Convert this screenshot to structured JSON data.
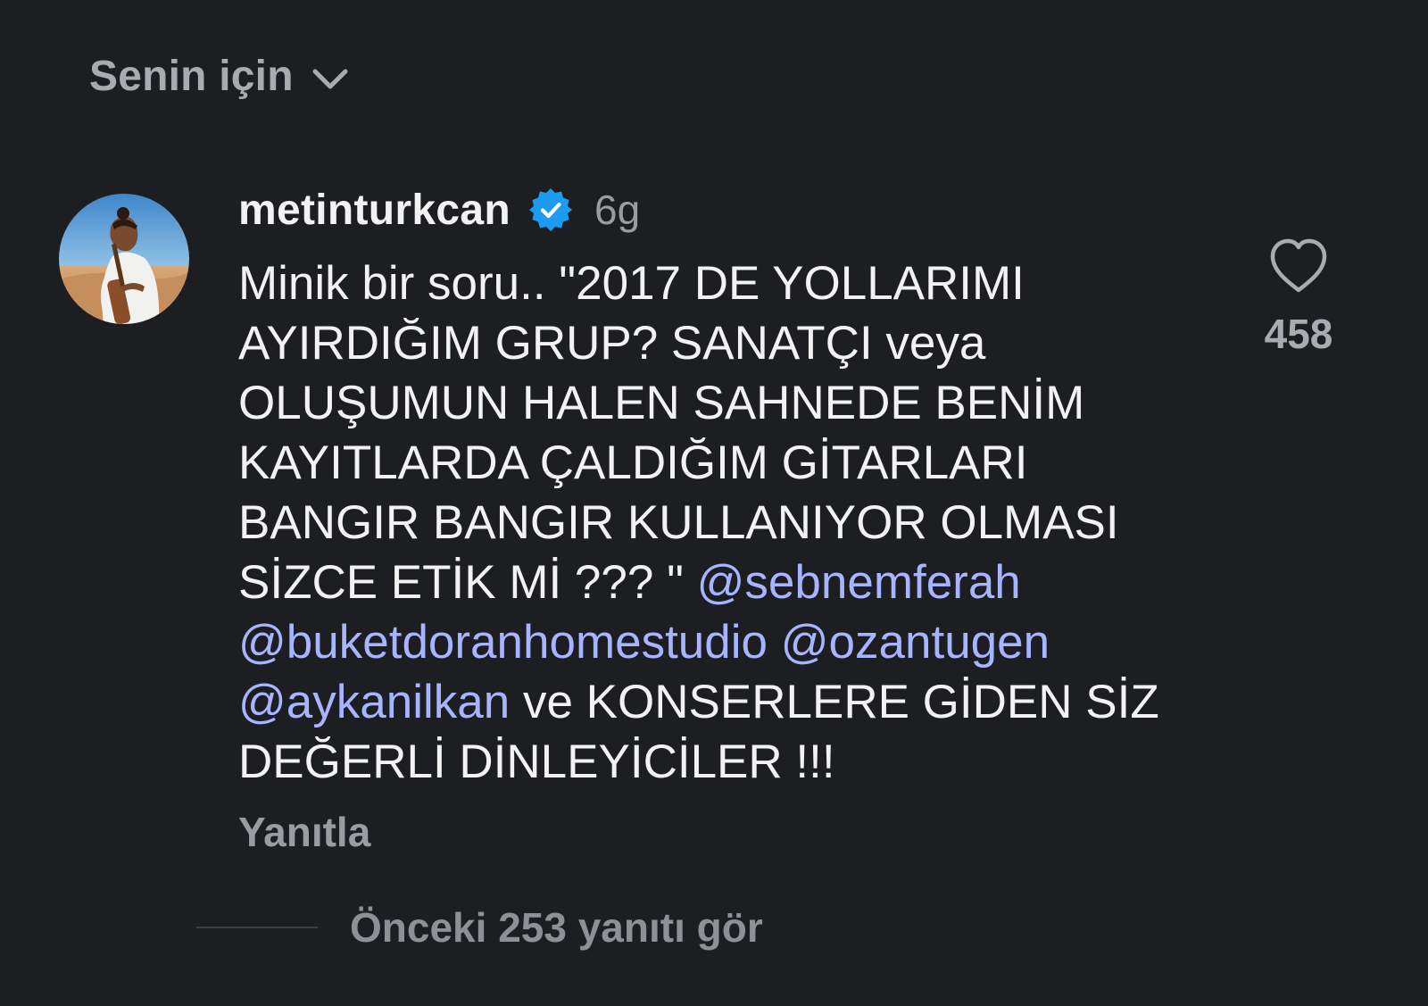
{
  "header": {
    "feed_selector_label": "Senin için",
    "chevron_icon": "chevron-down-icon"
  },
  "comment": {
    "avatar_icon": "avatar",
    "username": "metinturkcan",
    "verified_icon": "verified-badge-icon",
    "time": "6g",
    "text_parts": {
      "p1": "Minik bir soru.. \"2017 DE YOLLARIMI\nAYIRDIĞIM GRUP? SANATÇI veya\nOLUŞUMUN HALEN SAHNEDE BENİM\nKAYITLARDA ÇALDIĞIM GİTARLARI\nBANGIR BANGIR KULLANIYOR OLMASI\nSİZCE ETİK  Mİ ??? \" ",
      "m1": "@sebnemferah",
      "m2": "@buketdoranhomestudio",
      "m3": "@ozantugen",
      "m4": "@aykanilkan",
      "p2": " ve KONSERLERE GİDEN SİZ\nDEĞERLİ DİNLEYİCİLER !!!"
    },
    "reply_label": "Yanıtla",
    "like_icon": "heart-icon",
    "like_count": "458"
  },
  "replies": {
    "view_label": "Önceki 253 yanıtı gör"
  },
  "colors": {
    "background": "#1c1e22",
    "mention": "#a7b4ff",
    "verified": "#1d9bf0",
    "muted_text": "#9a9ca1"
  }
}
